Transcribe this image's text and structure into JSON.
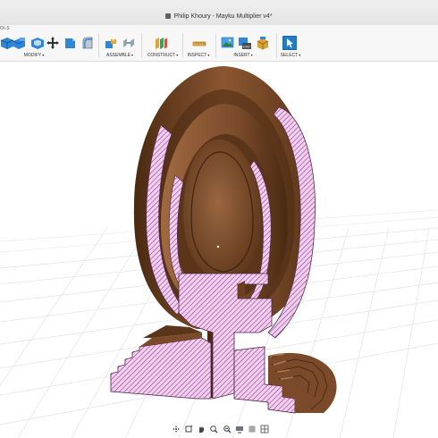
{
  "window": {
    "document_title": "Philip Khoury - Mayku Multiplier v4*",
    "workspace_tab_fragment": "OLS"
  },
  "toolbar": {
    "groups": [
      {
        "label": "MODIFY",
        "caret": "▾",
        "icons": [
          "press-pull-icon",
          "fillet-icon",
          "move-icon",
          "shell-icon",
          "split-body-icon"
        ]
      },
      {
        "label": "ASSEMBLE",
        "caret": "▾",
        "icons": [
          "new-component-icon",
          "joint-icon"
        ]
      },
      {
        "label": "CONSTRUCT",
        "caret": "▾",
        "icons": [
          "offset-plane-icon"
        ]
      },
      {
        "label": "INSPECT",
        "caret": "▾",
        "icons": [
          "measure-icon"
        ]
      },
      {
        "label": "INSERT",
        "caret": "▾",
        "icons": [
          "insert-image-icon",
          "insert-svg-icon",
          "insert-mcmaster-icon"
        ]
      },
      {
        "label": "SELECT",
        "caret": "▾",
        "icons": [
          "select-arrow-icon"
        ]
      }
    ]
  },
  "viewport": {
    "grid_visible": true,
    "model": "egg section view",
    "section_color": "#f0c8f0",
    "body_color": "#7a4a2b"
  },
  "navbar": {
    "tools": [
      "orbit-icon",
      "look-at-icon",
      "pan-icon",
      "zoom-icon",
      "fit-icon",
      "display-settings-icon",
      "grid-settings-icon",
      "viewports-icon"
    ]
  },
  "colors": {
    "toolbar_bg": "#f7f7f7",
    "accent_blue": "#1f7cc8",
    "wood_dark": "#5a3519",
    "wood_mid": "#7a4a2b",
    "wood_light": "#9a6a44"
  }
}
